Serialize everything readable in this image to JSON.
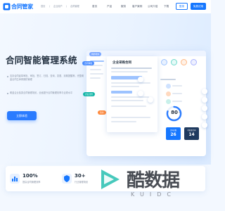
{
  "header": {
    "logo_text": "合同管家",
    "breadcrumb": [
      "首页",
      "企业用户",
      "合同管理"
    ],
    "nav": [
      "首页",
      "产品",
      "服务",
      "客户案例",
      "公司介绍",
      "下载"
    ],
    "login_label": "登录",
    "trial_label": "免费试用"
  },
  "hero": {
    "title": "合同智能管理系统",
    "bullets": [
      "支持合同起草审批、审批、签订、归档、查询、变更、到期提醒等，完整覆盖合同生命周期的管理",
      "覆盖企业各类合同管理场景，全面提升合同管理效率与合规水平"
    ],
    "cta_label": "立即体验"
  },
  "dashboard": {
    "doc_title": "企业采购合同",
    "tags": [
      "合同审批",
      "签约",
      "审核",
      "企业法务",
      "我的待办"
    ],
    "gauge": {
      "value": 80,
      "unit": "%",
      "percent": 80
    },
    "stat_cards": [
      {
        "label": "合同总数",
        "value": "26"
      },
      {
        "label": "待处理合同",
        "value": "14"
      }
    ]
  },
  "stats": [
    {
      "value": "100%",
      "label": "提高合同管理效率",
      "icon": "chart-icon"
    },
    {
      "value": "30+",
      "label": "行业管理场景",
      "icon": "shield-icon"
    }
  ],
  "watermark": {
    "text": "酷数据",
    "sub": "KUIDC"
  },
  "colors": {
    "primary": "#1677ff",
    "accent_orange": "#ff8a3d",
    "teal": "#16b6a8",
    "dark_navy": "#1f3a5f"
  }
}
